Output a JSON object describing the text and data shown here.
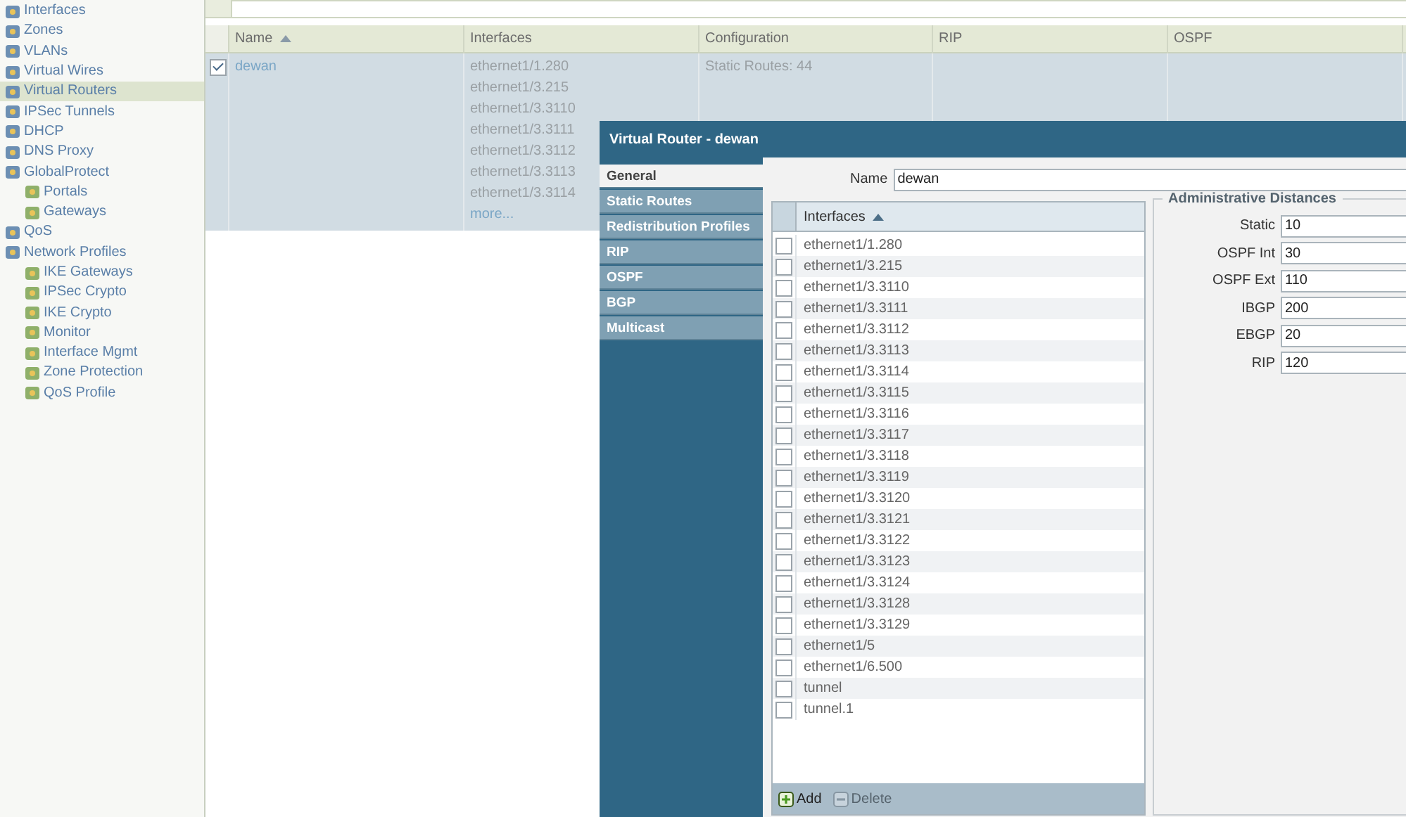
{
  "sidebar": {
    "items": [
      {
        "label": "Interfaces",
        "selected": false
      },
      {
        "label": "Zones",
        "selected": false
      },
      {
        "label": "VLANs",
        "selected": false
      },
      {
        "label": "Virtual Wires",
        "selected": false
      },
      {
        "label": "Virtual Routers",
        "selected": true
      },
      {
        "label": "IPSec Tunnels",
        "selected": false
      },
      {
        "label": "DHCP",
        "selected": false
      },
      {
        "label": "DNS Proxy",
        "selected": false
      },
      {
        "label": "GlobalProtect",
        "selected": false,
        "children": [
          {
            "label": "Portals",
            "selected": false
          },
          {
            "label": "Gateways",
            "selected": false
          }
        ]
      },
      {
        "label": "QoS",
        "selected": false
      },
      {
        "label": "Network Profiles",
        "selected": false,
        "children": [
          {
            "label": "IKE Gateways",
            "selected": false
          },
          {
            "label": "IPSec Crypto",
            "selected": false
          },
          {
            "label": "IKE Crypto",
            "selected": false
          },
          {
            "label": "Monitor",
            "selected": false
          },
          {
            "label": "Interface Mgmt",
            "selected": false
          },
          {
            "label": "Zone Protection",
            "selected": false
          },
          {
            "label": "QoS Profile",
            "selected": false
          }
        ]
      }
    ]
  },
  "table": {
    "columns": [
      {
        "label": "Name",
        "sorted": true
      },
      {
        "label": "Interfaces",
        "sorted": false
      },
      {
        "label": "Configuration",
        "sorted": false
      },
      {
        "label": "RIP",
        "sorted": false
      },
      {
        "label": "OSPF",
        "sorted": false
      }
    ],
    "rows": [
      {
        "checked": true,
        "name": "dewan",
        "interfaces": [
          "ethernet1/1.280",
          "ethernet1/3.215",
          "ethernet1/3.3110",
          "ethernet1/3.3111",
          "ethernet1/3.3112",
          "ethernet1/3.3113",
          "ethernet1/3.3114"
        ],
        "more": "more...",
        "configuration": "Static Routes: 44"
      }
    ]
  },
  "dialog": {
    "title": "Virtual Router - dewan",
    "tabs": [
      {
        "label": "General",
        "selected": true
      },
      {
        "label": "Static Routes",
        "selected": false
      },
      {
        "label": "Redistribution Profiles",
        "selected": false
      },
      {
        "label": "RIP",
        "selected": false
      },
      {
        "label": "OSPF",
        "selected": false
      },
      {
        "label": "BGP",
        "selected": false
      },
      {
        "label": "Multicast",
        "selected": false
      }
    ],
    "name_label": "Name",
    "name_value": "dewan",
    "interfaces_grid": {
      "column": "Interfaces",
      "rows": [
        {
          "label": "ethernet1/1.280",
          "checked": false
        },
        {
          "label": "ethernet1/3.215",
          "checked": false
        },
        {
          "label": "ethernet1/3.3110",
          "checked": false
        },
        {
          "label": "ethernet1/3.3111",
          "checked": false
        },
        {
          "label": "ethernet1/3.3112",
          "checked": false
        },
        {
          "label": "ethernet1/3.3113",
          "checked": false
        },
        {
          "label": "ethernet1/3.3114",
          "checked": false
        },
        {
          "label": "ethernet1/3.3115",
          "checked": false
        },
        {
          "label": "ethernet1/3.3116",
          "checked": false
        },
        {
          "label": "ethernet1/3.3117",
          "checked": false
        },
        {
          "label": "ethernet1/3.3118",
          "checked": false
        },
        {
          "label": "ethernet1/3.3119",
          "checked": false
        },
        {
          "label": "ethernet1/3.3120",
          "checked": false
        },
        {
          "label": "ethernet1/3.3121",
          "checked": false
        },
        {
          "label": "ethernet1/3.3122",
          "checked": false
        },
        {
          "label": "ethernet1/3.3123",
          "checked": false
        },
        {
          "label": "ethernet1/3.3124",
          "checked": false
        },
        {
          "label": "ethernet1/3.3128",
          "checked": false
        },
        {
          "label": "ethernet1/3.3129",
          "checked": false
        },
        {
          "label": "ethernet1/5",
          "checked": false
        },
        {
          "label": "ethernet1/6.500",
          "checked": false
        },
        {
          "label": "tunnel",
          "checked": false
        },
        {
          "label": "tunnel.1",
          "checked": false
        }
      ],
      "buttons": [
        {
          "label": "Add",
          "kind": "add",
          "disabled": false
        },
        {
          "label": "Delete",
          "kind": "delete",
          "disabled": true
        }
      ]
    },
    "admin_distances": {
      "title": "Administrative Distances",
      "fields": [
        {
          "label": "Static",
          "value": "10"
        },
        {
          "label": "OSPF Int",
          "value": "30"
        },
        {
          "label": "OSPF Ext",
          "value": "110"
        },
        {
          "label": "IBGP",
          "value": "200"
        },
        {
          "label": "EBGP",
          "value": "20"
        },
        {
          "label": "RIP",
          "value": "120"
        }
      ]
    }
  }
}
